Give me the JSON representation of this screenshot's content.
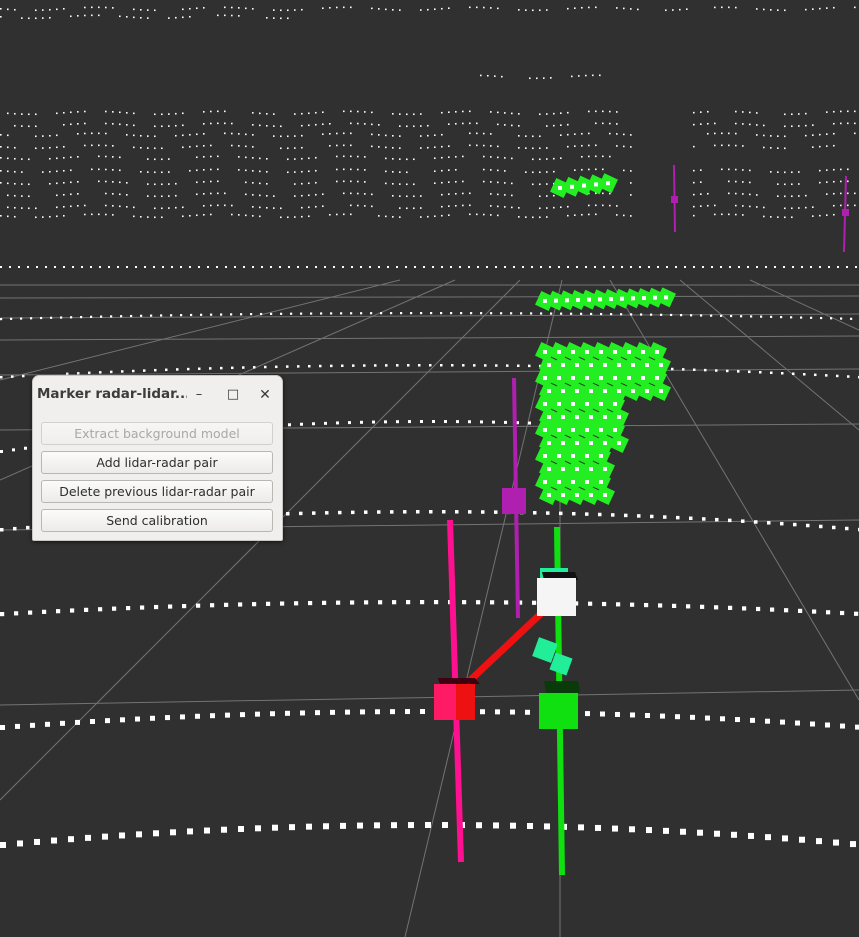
{
  "dialog": {
    "title": "Marker radar-lidar...",
    "minimize_glyph": "–",
    "maximize_glyph": "□",
    "close_glyph": "✕",
    "buttons": {
      "extract_background": "Extract background model",
      "add_pair": "Add lidar-radar pair",
      "delete_pair": "Delete previous lidar-radar pair",
      "send_calibration": "Send calibration"
    },
    "extract_background_enabled": false
  },
  "scene": {
    "background_color": "#303030",
    "colors": {
      "grid": "#8a8a8a",
      "lidar_points": "#ffffff",
      "cluster_points": "#22ee22",
      "radar_marker": "#ff1a66",
      "lidar_marker": "#10e010",
      "selected_marker": "#f5f5f5",
      "pair_link": "#ee1111",
      "other_radar": "#b020b0",
      "teal_points": "#22ee99"
    },
    "icons": [
      "radar-marker-icon",
      "lidar-marker-icon",
      "selected-marker-icon",
      "pair-link-line"
    ]
  }
}
